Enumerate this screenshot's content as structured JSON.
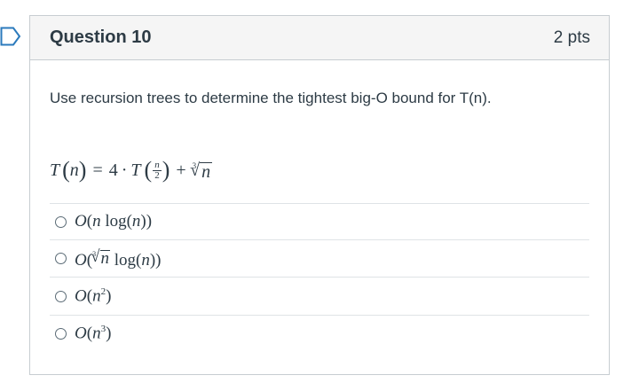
{
  "question": {
    "title": "Question 10",
    "points": "2 pts",
    "prompt": "Use recursion trees to determine the tightest big-O bound for T(n)."
  },
  "equation": {
    "lhs": "T",
    "lhs_arg": "n",
    "coef": "4",
    "func": "T",
    "frac_num": "n",
    "frac_den": "2",
    "root_index": "3",
    "root_radicand": "n"
  },
  "answers": [
    {
      "text": "O(n log(n))"
    },
    {
      "text": "O(∛n log(n))"
    },
    {
      "text": "O(n²)"
    },
    {
      "text": "O(n³)"
    }
  ],
  "colors": {
    "accent": "#2b7abc",
    "header_bg": "#f5f5f5",
    "border": "#c7cdd1",
    "text": "#2d3b45"
  }
}
